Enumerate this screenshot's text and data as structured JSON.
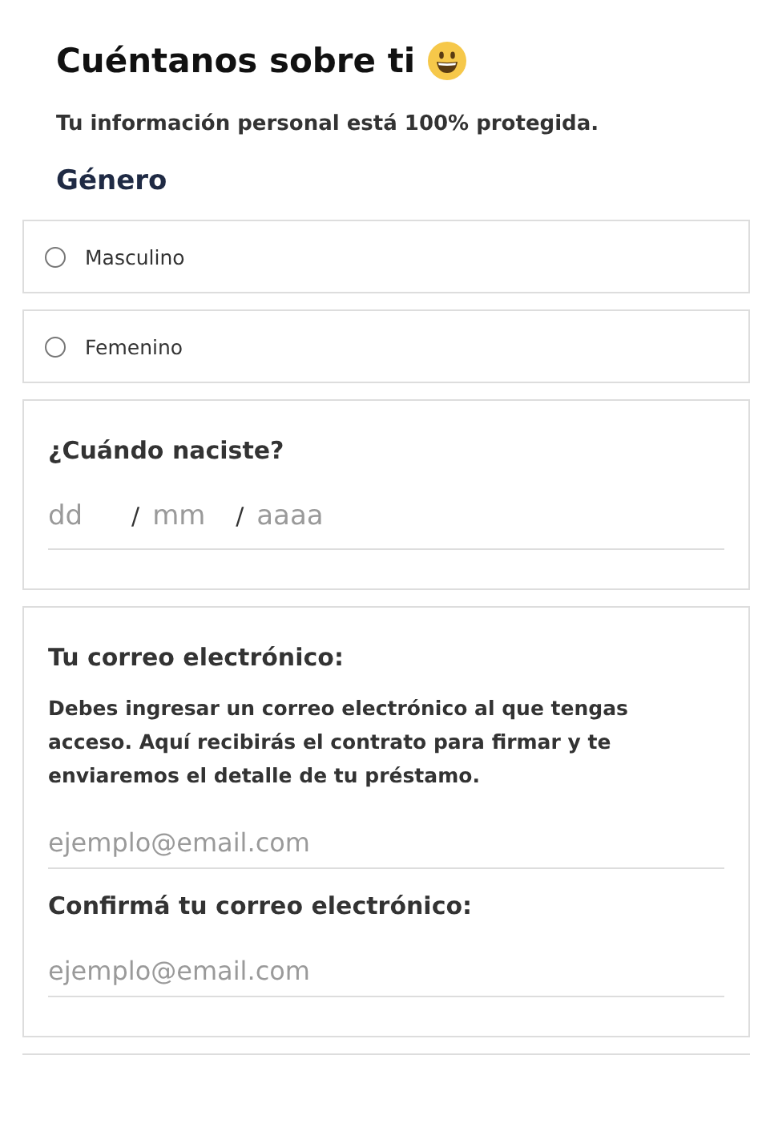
{
  "title": "Cuéntanos sobre ti",
  "subtitle": "Tu información personal está 100% protegida.",
  "gender": {
    "label": "Género",
    "options": [
      {
        "label": "Masculino",
        "selected": false
      },
      {
        "label": "Femenino",
        "selected": false
      }
    ]
  },
  "birth": {
    "label": "¿Cuándo naciste?",
    "fields": [
      {
        "placeholder": "dd"
      },
      {
        "placeholder": "mm"
      },
      {
        "placeholder": "aaaa"
      }
    ],
    "separator": "/"
  },
  "email": {
    "label": "Tu correo electrónico:",
    "help": "Debes ingresar un correo electrónico al que tengas acceso. Aquí recibirás el contrato para firmar y te enviaremos el detalle de tu préstamo.",
    "placeholder": "ejemplo@email.com",
    "confirm_label": "Confirmá tu correo electrónico:",
    "confirm_placeholder": "ejemplo@email.com"
  }
}
